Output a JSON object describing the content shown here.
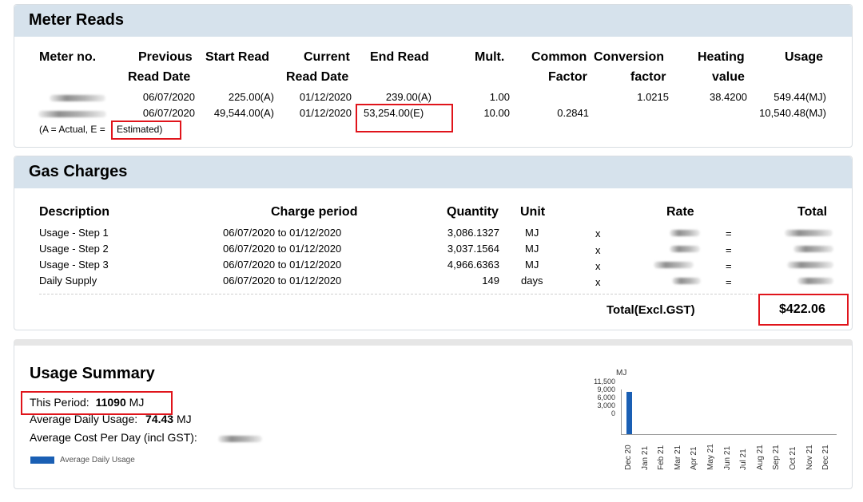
{
  "meter_reads": {
    "title": "Meter Reads",
    "headers": {
      "meter_no": "Meter no.",
      "prev_l1": "Previous",
      "prev_l2": "Read Date",
      "start_read": "Start Read",
      "curr_l1": "Current",
      "curr_l2": "Read Date",
      "end_read": "End Read",
      "mult": "Mult.",
      "common_l1": "Common",
      "common_l2": "Factor",
      "conv_l1": "Conversion",
      "conv_l2": "factor",
      "heat_l1": "Heating",
      "heat_l2": "value",
      "usage": "Usage"
    },
    "rows": [
      {
        "prev_date": "06/07/2020",
        "start_read": "225.00(A)",
        "curr_date": "01/12/2020",
        "end_read": "239.00(A)",
        "mult": "1.00",
        "common": "",
        "conv": "1.0215",
        "heat": "38.4200",
        "usage": "549.44(MJ)"
      },
      {
        "prev_date": "06/07/2020",
        "start_read": "49,544.00(A)",
        "curr_date": "01/12/2020",
        "end_read": "53,254.00(E)",
        "mult": "10.00",
        "common": "0.2841",
        "conv": "",
        "heat": "",
        "usage": "10,540.48(MJ)"
      }
    ],
    "legend_prefix": "(A = Actual, E =",
    "legend_estimated": "Estimated)"
  },
  "gas_charges": {
    "title": "Gas Charges",
    "headers": {
      "description": "Description",
      "period": "Charge period",
      "quantity": "Quantity",
      "unit": "Unit",
      "rate": "Rate",
      "total": "Total"
    },
    "rows": [
      {
        "description": "Usage - Step 1",
        "period": "06/07/2020 to 01/12/2020",
        "quantity": "3,086.1327",
        "unit": "MJ",
        "x": "x",
        "eq": "="
      },
      {
        "description": "Usage - Step 2",
        "period": "06/07/2020 to 01/12/2020",
        "quantity": "3,037.1564",
        "unit": "MJ",
        "x": "x",
        "eq": "="
      },
      {
        "description": "Usage - Step 3",
        "period": "06/07/2020 to 01/12/2020",
        "quantity": "4,966.6363",
        "unit": "MJ",
        "x": "x",
        "eq": "="
      },
      {
        "description": "Daily Supply",
        "period": "06/07/2020 to 01/12/2020",
        "quantity": "149",
        "unit": "days",
        "x": "x",
        "eq": "="
      }
    ],
    "total_label": "Total(Excl.GST)",
    "total_value": "$422.06"
  },
  "usage_summary": {
    "title": "Usage Summary",
    "this_period_label": "This Period:",
    "this_period_value": "11090",
    "this_period_unit": "MJ",
    "avg_daily_label": "Average Daily Usage:",
    "avg_daily_value": "74.43",
    "avg_daily_unit": "MJ",
    "avg_cost_label": "Average Cost Per Day (incl GST):",
    "legend_label": "Average Daily Usage",
    "bar_color": "#1a5fb4"
  },
  "chart_data": {
    "type": "bar",
    "ylabel": "MJ",
    "yticks": [
      "11,500",
      "9,000",
      "6,000",
      "3,000",
      "0"
    ],
    "ylim": [
      0,
      11500
    ],
    "categories": [
      "Dec 20",
      "Jan 21",
      "Feb 21",
      "Mar 21",
      "Apr 21",
      "May 21",
      "Jun 21",
      "Jul 21",
      "Aug 21",
      "Sep 21",
      "Oct 21",
      "Nov 21",
      "Dec 21"
    ],
    "values": [
      11090,
      0,
      0,
      0,
      0,
      0,
      0,
      0,
      0,
      0,
      0,
      0,
      0
    ],
    "legend": "Average Daily Usage"
  }
}
